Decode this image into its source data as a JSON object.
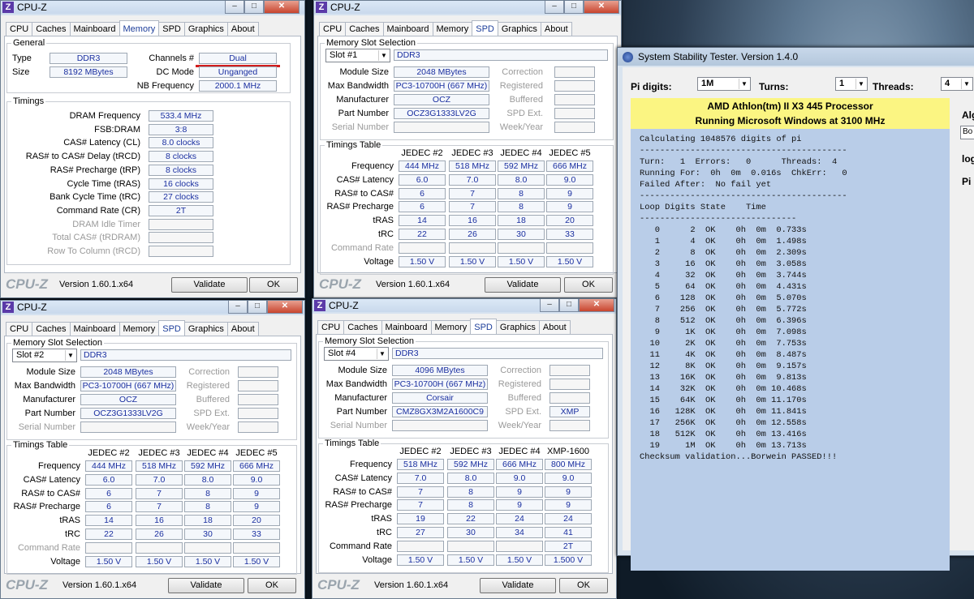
{
  "cpuz1": {
    "title": "CPU-Z",
    "tabs": [
      "CPU",
      "Caches",
      "Mainboard",
      "Memory",
      "SPD",
      "Graphics",
      "About"
    ],
    "active": "Memory",
    "general": "General",
    "type_label": "Type",
    "type": "DDR3",
    "size_label": "Size",
    "size": "8192 MBytes",
    "channels_label": "Channels #",
    "channels": "Dual",
    "dcmode_label": "DC Mode",
    "dcmode": "Unganged",
    "nbfreq_label": "NB Frequency",
    "nbfreq": "2000.1 MHz",
    "timings": "Timings",
    "rows": [
      {
        "l": "DRAM Frequency",
        "v": "533.4 MHz"
      },
      {
        "l": "FSB:DRAM",
        "v": "3:8"
      },
      {
        "l": "CAS# Latency (CL)",
        "v": "8.0 clocks"
      },
      {
        "l": "RAS# to CAS# Delay (tRCD)",
        "v": "8 clocks"
      },
      {
        "l": "RAS# Precharge (tRP)",
        "v": "8 clocks"
      },
      {
        "l": "Cycle Time (tRAS)",
        "v": "16 clocks"
      },
      {
        "l": "Bank Cycle Time (tRC)",
        "v": "27 clocks"
      },
      {
        "l": "Command Rate (CR)",
        "v": "2T"
      },
      {
        "l": "DRAM Idle Timer",
        "v": ""
      },
      {
        "l": "Total CAS# (tRDRAM)",
        "v": ""
      },
      {
        "l": "Row To Column (tRCD)",
        "v": ""
      }
    ],
    "version": "Version 1.60.1.x64",
    "validate": "Validate",
    "ok": "OK",
    "logo": "CPU-Z"
  },
  "spd_common": {
    "tabs": [
      "CPU",
      "Caches",
      "Mainboard",
      "Memory",
      "SPD",
      "Graphics",
      "About"
    ],
    "active": "SPD",
    "group": "Memory Slot Selection",
    "labels": [
      "Module Size",
      "Max Bandwidth",
      "Manufacturer",
      "Part Number",
      "Serial Number"
    ],
    "rlabels": [
      "Correction",
      "Registered",
      "Buffered",
      "SPD Ext.",
      "Week/Year"
    ],
    "ttitle": "Timings Table",
    "tlabels": [
      "Frequency",
      "CAS# Latency",
      "RAS# to CAS#",
      "RAS# Precharge",
      "tRAS",
      "tRC",
      "Command Rate",
      "Voltage"
    ],
    "version": "Version 1.60.1.x64",
    "validate": "Validate",
    "ok": "OK",
    "logo": "CPU-Z",
    "title": "CPU-Z"
  },
  "spd1": {
    "slot": "Slot #1",
    "type": "DDR3",
    "vals": [
      "2048 MBytes",
      "PC3-10700H (667 MHz)",
      "OCZ",
      "OCZ3G1333LV2G",
      ""
    ],
    "rvals": [
      "",
      "",
      "",
      "",
      ""
    ],
    "cols": [
      "JEDEC #2",
      "JEDEC #3",
      "JEDEC #4",
      "JEDEC #5"
    ],
    "grid": [
      [
        "444 MHz",
        "518 MHz",
        "592 MHz",
        "666 MHz"
      ],
      [
        "6.0",
        "7.0",
        "8.0",
        "9.0"
      ],
      [
        "6",
        "7",
        "8",
        "9"
      ],
      [
        "6",
        "7",
        "8",
        "9"
      ],
      [
        "14",
        "16",
        "18",
        "20"
      ],
      [
        "22",
        "26",
        "30",
        "33"
      ],
      [
        "",
        "",
        "",
        ""
      ],
      [
        "1.50 V",
        "1.50 V",
        "1.50 V",
        "1.50 V"
      ]
    ]
  },
  "spd2": {
    "slot": "Slot #2",
    "type": "DDR3",
    "vals": [
      "2048 MBytes",
      "PC3-10700H (667 MHz)",
      "OCZ",
      "OCZ3G1333LV2G",
      ""
    ],
    "rvals": [
      "",
      "",
      "",
      "",
      ""
    ],
    "cols": [
      "JEDEC #2",
      "JEDEC #3",
      "JEDEC #4",
      "JEDEC #5"
    ],
    "grid": [
      [
        "444 MHz",
        "518 MHz",
        "592 MHz",
        "666 MHz"
      ],
      [
        "6.0",
        "7.0",
        "8.0",
        "9.0"
      ],
      [
        "6",
        "7",
        "8",
        "9"
      ],
      [
        "6",
        "7",
        "8",
        "9"
      ],
      [
        "14",
        "16",
        "18",
        "20"
      ],
      [
        "22",
        "26",
        "30",
        "33"
      ],
      [
        "",
        "",
        "",
        ""
      ],
      [
        "1.50 V",
        "1.50 V",
        "1.50 V",
        "1.50 V"
      ]
    ]
  },
  "spd4": {
    "slot": "Slot #4",
    "type": "DDR3",
    "vals": [
      "4096 MBytes",
      "PC3-10700H (667 MHz)",
      "Corsair",
      "CMZ8GX3M2A1600C9",
      ""
    ],
    "rvals": [
      "",
      "",
      "",
      "XMP",
      ""
    ],
    "cols": [
      "JEDEC #2",
      "JEDEC #3",
      "JEDEC #4",
      "XMP-1600"
    ],
    "grid": [
      [
        "518 MHz",
        "592 MHz",
        "666 MHz",
        "800 MHz"
      ],
      [
        "7.0",
        "8.0",
        "9.0",
        "9.0"
      ],
      [
        "7",
        "8",
        "9",
        "9"
      ],
      [
        "7",
        "8",
        "9",
        "9"
      ],
      [
        "19",
        "22",
        "24",
        "24"
      ],
      [
        "27",
        "30",
        "34",
        "41"
      ],
      [
        "",
        "",
        "",
        "2T"
      ],
      [
        "1.50 V",
        "1.50 V",
        "1.50 V",
        "1.500 V"
      ]
    ]
  },
  "sst": {
    "title": "System Stability Tester. Version 1.4.0",
    "pi_label": "Pi digits:",
    "pi": "1M",
    "turns_label": "Turns:",
    "turns": "1",
    "threads_label": "Threads:",
    "threads": "4",
    "cpu": "AMD Athlon(tm) II X3 445 Processor",
    "os": "Running Microsoft Windows at 3100 MHz",
    "side1": "Alg",
    "side2": "Bo",
    "side3": "log",
    "side4": "Pi",
    "console": "Calculating 1048576 digits of pi\n-----------------------------------------\nTurn:   1  Errors:   0      Threads:  4\nRunning For:  0h  0m  0.016s  ChkErr:   0\nFailed After:  No fail yet\n-----------------------------------------\nLoop Digits State    Time\n-------------------------------\n   0      2  OK    0h  0m  0.733s\n   1      4  OK    0h  0m  1.498s\n   2      8  OK    0h  0m  2.309s\n   3     16  OK    0h  0m  3.058s\n   4     32  OK    0h  0m  3.744s\n   5     64  OK    0h  0m  4.431s\n   6    128  OK    0h  0m  5.070s\n   7    256  OK    0h  0m  5.772s\n   8    512  OK    0h  0m  6.396s\n   9     1K  OK    0h  0m  7.098s\n  10     2K  OK    0h  0m  7.753s\n  11     4K  OK    0h  0m  8.487s\n  12     8K  OK    0h  0m  9.157s\n  13    16K  OK    0h  0m  9.813s\n  14    32K  OK    0h  0m 10.468s\n  15    64K  OK    0h  0m 11.170s\n  16   128K  OK    0h  0m 11.841s\n  17   256K  OK    0h  0m 12.558s\n  18   512K  OK    0h  0m 13.416s\n  19     1M  OK    0h  0m 13.713s\nChecksum validation...Borwein PASSED!!!"
  }
}
